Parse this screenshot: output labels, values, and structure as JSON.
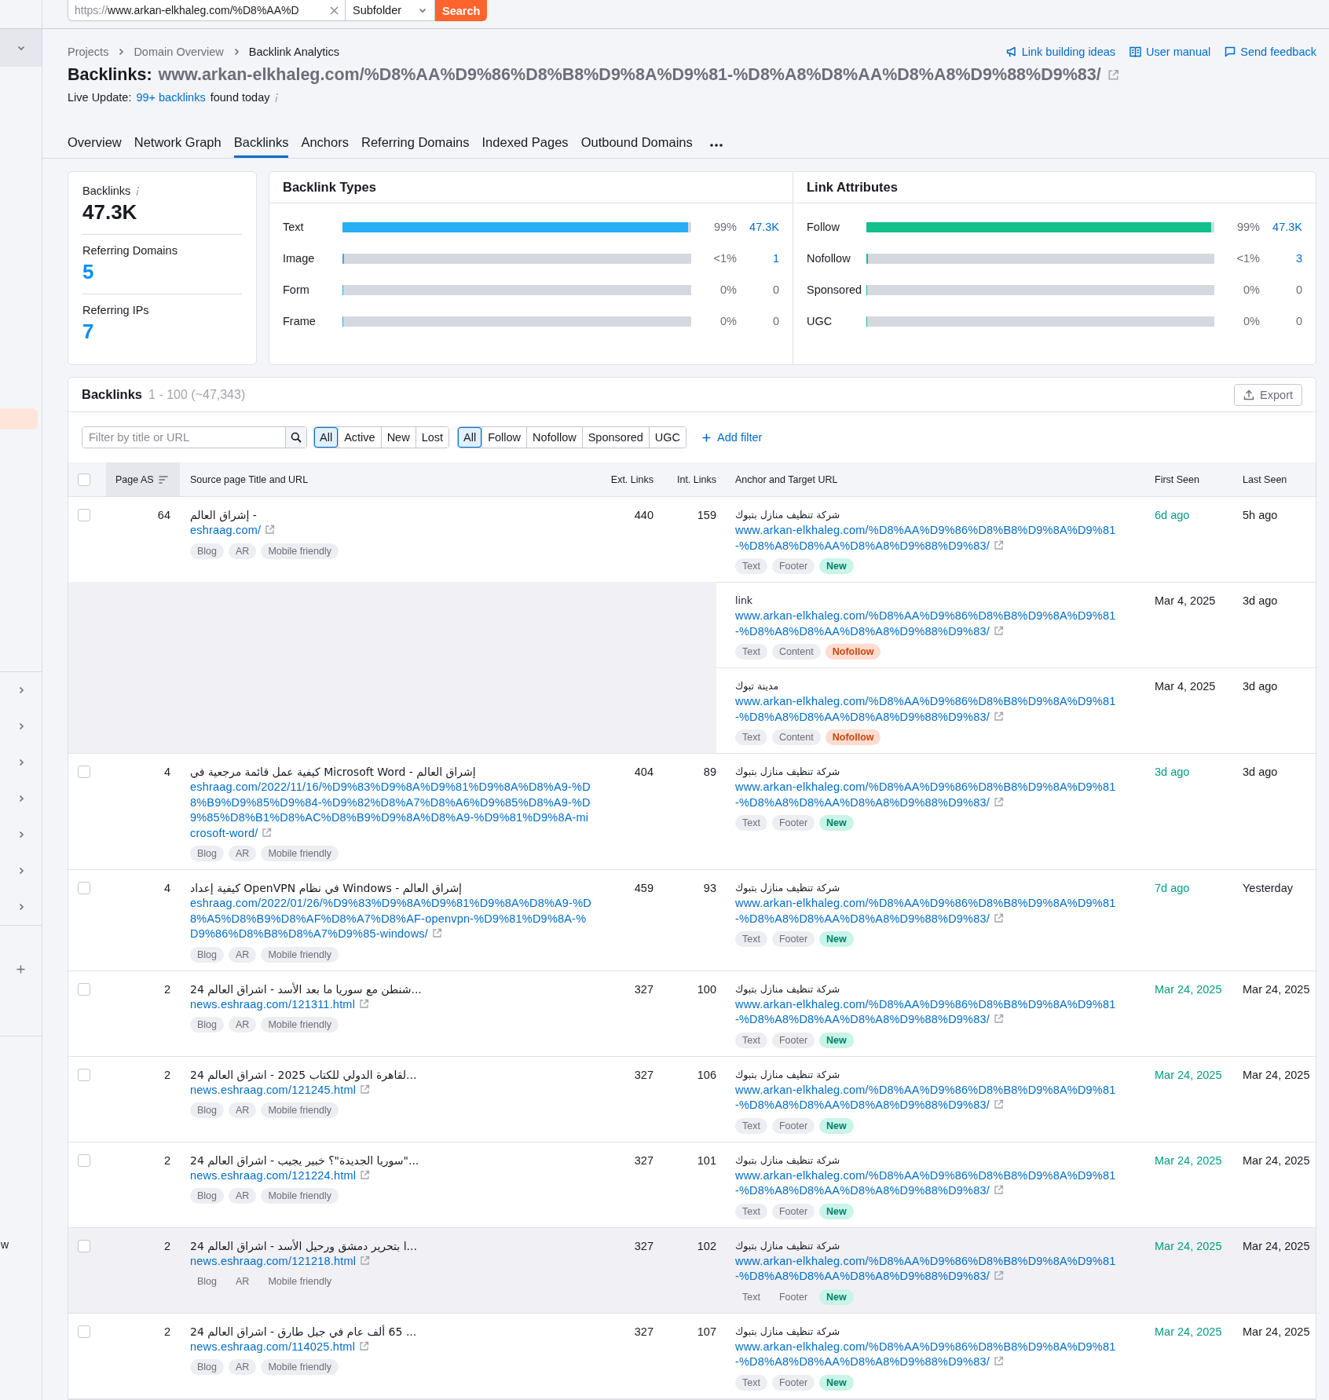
{
  "search_bar": {
    "url_prefix": "https://",
    "url": "www.arkan-elkhaleg.com/%D8%AA%D",
    "scope": "Subfolder",
    "button": "Search"
  },
  "sidebar": {
    "items": [
      {
        "expanded": false
      },
      {
        "expanded": false
      },
      {
        "expanded": false
      },
      {
        "expanded": false
      },
      {
        "expanded": false
      },
      {
        "expanded": false
      },
      {
        "expanded": false
      }
    ],
    "cut_label": "w"
  },
  "breadcrumbs": [
    "Projects",
    "Domain Overview",
    "Backlink Analytics"
  ],
  "header_links": [
    {
      "label": "Link building ideas",
      "kind": "megaphone"
    },
    {
      "label": "User manual",
      "kind": "book"
    },
    {
      "label": "Send feedback",
      "kind": "chat"
    }
  ],
  "title": {
    "label": "Backlinks:",
    "target": "www.arkan-elkhaleg.com/%D8%AA%D9%86%D8%B8%D9%8A%D9%81-%D8%A8%D8%AA%D8%A8%D9%88%D9%83/"
  },
  "live_update": {
    "label": "Live Update:",
    "link": "99+ backlinks",
    "suffix": "found today"
  },
  "tabs": [
    {
      "label": "Overview",
      "selected": false
    },
    {
      "label": "Network Graph",
      "selected": false
    },
    {
      "label": "Backlinks",
      "selected": true
    },
    {
      "label": "Anchors",
      "selected": false
    },
    {
      "label": "Referring Domains",
      "selected": false
    },
    {
      "label": "Indexed Pages",
      "selected": false
    },
    {
      "label": "Outbound Domains",
      "selected": false
    }
  ],
  "summary": [
    {
      "label": "Backlinks",
      "value": "47.3K",
      "kind": "total"
    },
    {
      "label": "Referring Domains",
      "value": "5",
      "kind": "link"
    },
    {
      "label": "Referring IPs",
      "value": "7",
      "kind": "link"
    }
  ],
  "panels": [
    {
      "kind": "types",
      "title": "Backlink Types",
      "rows": [
        {
          "label": "Text",
          "level": 0.99,
          "percent": "99%",
          "count": "47.3K",
          "linked": true
        },
        {
          "label": "Image",
          "level": 0.005,
          "percent": "<1%",
          "count": "1",
          "linked": true
        },
        {
          "label": "Form",
          "level": 0,
          "percent": "0%",
          "count": "0",
          "linked": false
        },
        {
          "label": "Frame",
          "level": 0,
          "percent": "0%",
          "count": "0",
          "linked": false
        }
      ]
    },
    {
      "kind": "attributes",
      "title": "Link Attributes",
      "rows": [
        {
          "label": "Follow",
          "level": 0.99,
          "percent": "99%",
          "count": "47.3K",
          "linked": true
        },
        {
          "label": "Nofollow",
          "level": 0.005,
          "percent": "<1%",
          "count": "3",
          "linked": true
        },
        {
          "label": "Sponsored",
          "level": 0,
          "percent": "0%",
          "count": "0",
          "linked": false
        },
        {
          "label": "UGC",
          "level": 0,
          "percent": "0%",
          "count": "0",
          "linked": false
        }
      ]
    }
  ],
  "table_card": {
    "title": "Backlinks",
    "range": "1 - 100 (~47,343)",
    "export": "Export"
  },
  "filters": {
    "placeholder": "Filter by title or URL",
    "status": [
      {
        "label": "All",
        "selected": true
      },
      {
        "label": "Active",
        "selected": false
      },
      {
        "label": "New",
        "selected": false
      },
      {
        "label": "Lost",
        "selected": false
      }
    ],
    "type": [
      {
        "label": "All",
        "selected": true
      },
      {
        "label": "Follow",
        "selected": false
      },
      {
        "label": "Nofollow",
        "selected": false
      },
      {
        "label": "Sponsored",
        "selected": false
      },
      {
        "label": "UGC",
        "selected": false
      }
    ],
    "add_filter": "Add filter"
  },
  "select_all": {
    "checked": false
  },
  "columns": [
    {
      "label": "Page AS",
      "sorted": true
    },
    {
      "label": "Source page Title and URL",
      "sorted": false
    },
    {
      "label": "Ext. Links",
      "sorted": false
    },
    {
      "label": "Int. Links",
      "sorted": false
    },
    {
      "label": "Anchor and Target URL",
      "sorted": false
    },
    {
      "label": "First Seen",
      "sorted": false
    },
    {
      "label": "Last Seen",
      "sorted": false
    }
  ],
  "rows": [
    {
      "checked": false,
      "highlighted": false,
      "page_as": "64",
      "title": "- إشراق العالم",
      "url": "eshraag.com/",
      "tags": [
        "Blog",
        "AR",
        "Mobile friendly"
      ],
      "ext_links": "440",
      "int_links": "159",
      "links": [
        {
          "anchor": "شركة تنظيف منازل بتبوك",
          "target": "www.arkan-elkhaleg.com/%D8%AA%D9%86%D8%B8%D9%8A%D9%81-%D8%A8%D8%AA%D8%A8%D9%88%D9%83/",
          "tags": [
            {
              "label": "Text",
              "kind": "plain"
            },
            {
              "label": "Footer",
              "kind": "plain"
            },
            {
              "label": "New",
              "kind": "new"
            }
          ],
          "first_seen": "6d ago",
          "first_seen_new": true,
          "last_seen": "5h ago"
        },
        {
          "anchor": "link",
          "target": "www.arkan-elkhaleg.com/%D8%AA%D9%86%D8%B8%D9%8A%D9%81-%D8%A8%D8%AA%D8%A8%D9%88%D9%83/",
          "tags": [
            {
              "label": "Text",
              "kind": "plain"
            },
            {
              "label": "Content",
              "kind": "plain"
            },
            {
              "label": "Nofollow",
              "kind": "nofollow"
            }
          ],
          "first_seen": "Mar 4, 2025",
          "first_seen_new": false,
          "last_seen": "3d ago"
        },
        {
          "anchor": "مدينة تبوك",
          "target": "www.arkan-elkhaleg.com/%D8%AA%D9%86%D8%B8%D9%8A%D9%81-%D8%A8%D8%AA%D8%A8%D9%88%D9%83/",
          "tags": [
            {
              "label": "Text",
              "kind": "plain"
            },
            {
              "label": "Content",
              "kind": "plain"
            },
            {
              "label": "Nofollow",
              "kind": "nofollow"
            }
          ],
          "first_seen": "Mar 4, 2025",
          "first_seen_new": false,
          "last_seen": "3d ago"
        }
      ]
    },
    {
      "checked": false,
      "highlighted": false,
      "page_as": "4",
      "title": "إشراق العالم - Microsoft Word كيفية عمل قائمة مرجعية في",
      "url": "eshraag.com/2022/11/16/%D9%83%D9%8A%D9%81%D9%8A%D8%A9-%D8%B9%D9%85%D9%84-%D9%82%D8%A7%D8%A6%D9%85%D8%A9-%D9%85%D8%B1%D8%AC%D8%B9%D9%8A%D8%A9-%D9%81%D9%8A-microsoft-word/",
      "tags": [
        "Blog",
        "AR",
        "Mobile friendly"
      ],
      "ext_links": "404",
      "int_links": "89",
      "links": [
        {
          "anchor": "شركة تنظيف منازل بتبوك",
          "target": "www.arkan-elkhaleg.com/%D8%AA%D9%86%D8%B8%D9%8A%D9%81-%D8%A8%D8%AA%D8%A8%D9%88%D9%83/",
          "tags": [
            {
              "label": "Text",
              "kind": "plain"
            },
            {
              "label": "Footer",
              "kind": "plain"
            },
            {
              "label": "New",
              "kind": "new"
            }
          ],
          "first_seen": "3d ago",
          "first_seen_new": true,
          "last_seen": "3d ago"
        }
      ]
    },
    {
      "checked": false,
      "highlighted": false,
      "page_as": "4",
      "title": "إشراق العالم - Windows في نظام OpenVPN كيفية إعداد",
      "url": "eshraag.com/2022/01/26/%D9%83%D9%8A%D9%81%D9%8A%D8%A9-%D8%A5%D8%B9%D8%AF%D8%A7%D8%AF-openvpn-%D9%81%D9%8A-%D9%86%D8%B8%D8%A7%D9%85-windows/",
      "tags": [
        "Blog",
        "AR",
        "Mobile friendly"
      ],
      "ext_links": "459",
      "int_links": "93",
      "links": [
        {
          "anchor": "شركة تنظيف منازل بتبوك",
          "target": "www.arkan-elkhaleg.com/%D8%AA%D9%86%D8%B8%D9%8A%D9%81-%D8%A8%D8%AA%D8%A8%D9%88%D9%83/",
          "tags": [
            {
              "label": "Text",
              "kind": "plain"
            },
            {
              "label": "Footer",
              "kind": "plain"
            },
            {
              "label": "New",
              "kind": "new"
            }
          ],
          "first_seen": "7d ago",
          "first_seen_new": true,
          "last_seen": "Yesterday"
        }
      ]
    },
    {
      "checked": false,
      "highlighted": false,
      "page_as": "2",
      "title": "...شنطن مع سوريا ما بعد الأسد - اشراق العالم 24",
      "url": "news.eshraag.com/121311.html",
      "tags": [
        "Blog",
        "AR",
        "Mobile friendly"
      ],
      "ext_links": "327",
      "int_links": "100",
      "links": [
        {
          "anchor": "شركة تنظيف منازل بتبوك",
          "target": "www.arkan-elkhaleg.com/%D8%AA%D9%86%D8%B8%D9%8A%D9%81-%D8%A8%D8%AA%D8%A8%D9%88%D9%83/",
          "tags": [
            {
              "label": "Text",
              "kind": "plain"
            },
            {
              "label": "Footer",
              "kind": "plain"
            },
            {
              "label": "New",
              "kind": "new"
            }
          ],
          "first_seen": "Mar 24, 2025",
          "first_seen_new": true,
          "last_seen": "Mar 24, 2025"
        }
      ]
    },
    {
      "checked": false,
      "highlighted": false,
      "page_as": "2",
      "title": "...لقاهرة الدولي للكتاب 2025 - اشراق العالم 24",
      "url": "news.eshraag.com/121245.html",
      "tags": [
        "Blog",
        "AR",
        "Mobile friendly"
      ],
      "ext_links": "327",
      "int_links": "106",
      "links": [
        {
          "anchor": "شركة تنظيف منازل بتبوك",
          "target": "www.arkan-elkhaleg.com/%D8%AA%D9%86%D8%B8%D9%8A%D9%81-%D8%A8%D8%AA%D8%A8%D9%88%D9%83/",
          "tags": [
            {
              "label": "Text",
              "kind": "plain"
            },
            {
              "label": "Footer",
              "kind": "plain"
            },
            {
              "label": "New",
              "kind": "new"
            }
          ],
          "first_seen": "Mar 24, 2025",
          "first_seen_new": true,
          "last_seen": "Mar 24, 2025"
        }
      ]
    },
    {
      "checked": false,
      "highlighted": false,
      "page_as": "2",
      "title": "...\"سوريا الجديدة\"؟ خبير يجيب - اشراق العالم 24",
      "url": "news.eshraag.com/121224.html",
      "tags": [
        "Blog",
        "AR",
        "Mobile friendly"
      ],
      "ext_links": "327",
      "int_links": "101",
      "links": [
        {
          "anchor": "شركة تنظيف منازل بتبوك",
          "target": "www.arkan-elkhaleg.com/%D8%AA%D9%86%D8%B8%D9%8A%D9%81-%D8%A8%D8%AA%D8%A8%D9%88%D9%83/",
          "tags": [
            {
              "label": "Text",
              "kind": "plain"
            },
            {
              "label": "Footer",
              "kind": "plain"
            },
            {
              "label": "New",
              "kind": "new"
            }
          ],
          "first_seen": "Mar 24, 2025",
          "first_seen_new": true,
          "last_seen": "Mar 24, 2025"
        }
      ]
    },
    {
      "checked": false,
      "highlighted": true,
      "page_as": "2",
      "title": "...ا بتحرير دمشق ورحيل الأسد - اشراق العالم 24",
      "url": "news.eshraag.com/121218.html",
      "tags": [
        "Blog",
        "AR",
        "Mobile friendly"
      ],
      "ext_links": "327",
      "int_links": "102",
      "links": [
        {
          "anchor": "شركة تنظيف منازل بتبوك",
          "target": "www.arkan-elkhaleg.com/%D8%AA%D9%86%D8%B8%D9%8A%D9%81-%D8%A8%D8%AA%D8%A8%D9%88%D9%83/",
          "tags": [
            {
              "label": "Text",
              "kind": "plain"
            },
            {
              "label": "Footer",
              "kind": "plain"
            },
            {
              "label": "New",
              "kind": "new"
            }
          ],
          "first_seen": "Mar 24, 2025",
          "first_seen_new": true,
          "last_seen": "Mar 24, 2025"
        }
      ]
    },
    {
      "checked": false,
      "highlighted": false,
      "page_as": "2",
      "title": "... 65 ألف عام في جبل طارق - اشراق العالم 24",
      "url": "news.eshraag.com/114025.html",
      "tags": [
        "Blog",
        "AR",
        "Mobile friendly"
      ],
      "ext_links": "327",
      "int_links": "107",
      "links": [
        {
          "anchor": "شركة تنظيف منازل بتبوك",
          "target": "www.arkan-elkhaleg.com/%D8%AA%D9%86%D8%B8%D9%8A%D9%81-%D8%A8%D8%AA%D8%A8%D9%88%D9%83/",
          "tags": [
            {
              "label": "Text",
              "kind": "plain"
            },
            {
              "label": "Footer",
              "kind": "plain"
            },
            {
              "label": "New",
              "kind": "new"
            }
          ],
          "first_seen": "Mar 24, 2025",
          "first_seen_new": true,
          "last_seen": "Mar 24, 2025"
        }
      ]
    }
  ]
}
